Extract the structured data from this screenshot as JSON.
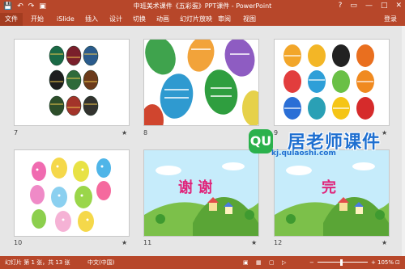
{
  "window": {
    "title": "中班美术课件《五彩蛋》PPT课件 - PowerPoint",
    "controls": [
      "?",
      "▭",
      "—",
      "□",
      "✕"
    ]
  },
  "quick_access": [
    "save-icon",
    "undo-icon",
    "redo-icon",
    "present-icon"
  ],
  "ribbon": {
    "tabs": [
      "文件",
      "开始",
      "iSlide",
      "插入",
      "设计",
      "切换",
      "动画",
      "幻灯片放映",
      "审阅",
      "视图"
    ],
    "login": "登录"
  },
  "slides": [
    {
      "number": "7",
      "star": "★"
    },
    {
      "number": "8",
      "star": "★"
    },
    {
      "number": "9",
      "star": "★"
    },
    {
      "number": "10",
      "star": "★"
    },
    {
      "number": "11",
      "star": "★",
      "text": "谢 谢"
    },
    {
      "number": "12",
      "star": "★",
      "text": "完"
    }
  ],
  "watermark": {
    "badge": "QU",
    "big": "居老师课件",
    "url": "kj.qulaoshi.com"
  },
  "status": {
    "slide_info": "幻灯片 第 1 张，共 13 张",
    "language": "中文(中国)",
    "zoom": "105%"
  },
  "colors": {
    "accent": "#b7472a",
    "watermark": "#1f6fd0",
    "title_text": "#e0247a"
  }
}
